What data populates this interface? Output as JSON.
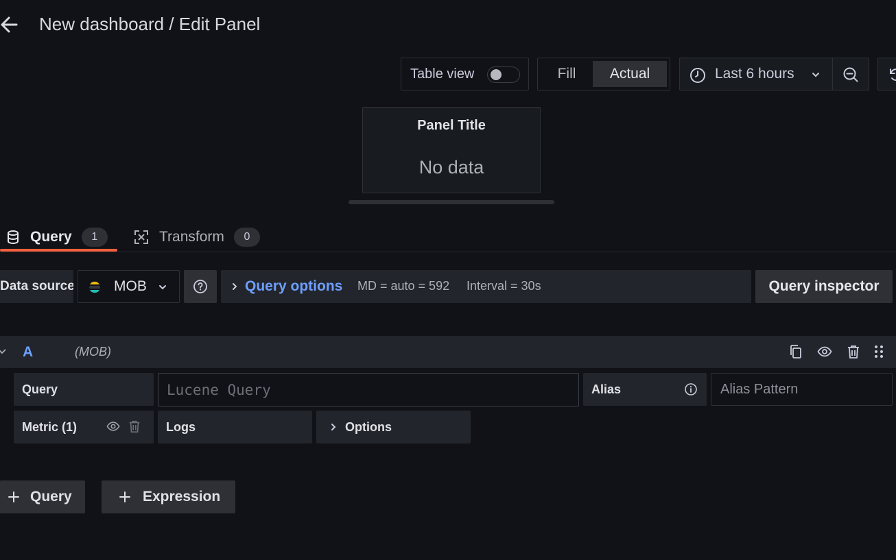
{
  "header": {
    "title": "New dashboard / Edit Panel"
  },
  "toolbar": {
    "table_view_label": "Table view",
    "table_view_on": false,
    "fill_label": "Fill",
    "actual_label": "Actual",
    "selected_mode": "Actual",
    "time_range_label": "Last 6 hours"
  },
  "panel": {
    "title": "Panel Title",
    "message": "No data"
  },
  "tabs": [
    {
      "label": "Query",
      "count": "1",
      "active": true
    },
    {
      "label": "Transform",
      "count": "0",
      "active": false
    }
  ],
  "datasource": {
    "label": "Data source",
    "name": "MOB",
    "query_options_label": "Query options",
    "md_text": "MD = auto = 592",
    "interval_text": "Interval = 30s",
    "inspector_label": "Query inspector"
  },
  "query_row": {
    "ref_id": "A",
    "datasource_name": "(MOB)",
    "query_label": "Query",
    "query_placeholder": "Lucene Query",
    "query_value": "",
    "alias_label": "Alias",
    "alias_placeholder": "Alias Pattern",
    "alias_value": "",
    "metric_label": "Metric (1)",
    "logs_label": "Logs",
    "options_label": "Options"
  },
  "add_buttons": {
    "query_label": "Query",
    "expression_label": "Expression"
  },
  "colors": {
    "background": "#111217",
    "panel": "#181b1f",
    "secondary": "#22252b",
    "accent_blue": "#6e9fff",
    "tab_underline": "#f55f3e"
  },
  "icons": [
    "arrow-left-icon",
    "clock-icon",
    "chevron-down-icon",
    "zoom-out-icon",
    "refresh-icon",
    "database-icon",
    "transform-icon",
    "elasticsearch-logo-icon",
    "question-circle-icon",
    "chevron-right-icon",
    "copy-icon",
    "eye-icon",
    "trash-icon",
    "drag-handle-icon",
    "info-circle-icon",
    "plus-icon"
  ]
}
